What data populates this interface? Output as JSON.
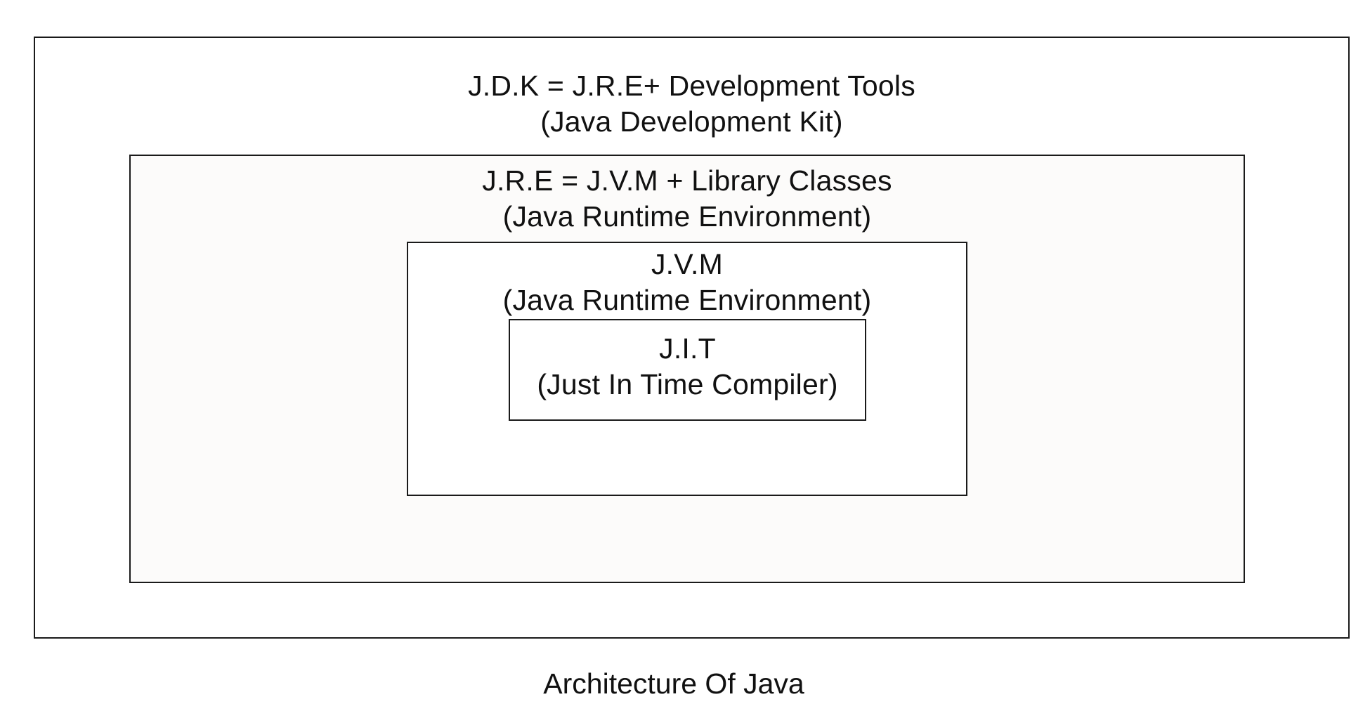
{
  "diagram": {
    "jdk": {
      "line1": "J.D.K = J.R.E+ Development Tools",
      "line2": "(Java Development Kit)"
    },
    "jre": {
      "line1": "J.R.E = J.V.M + Library Classes",
      "line2": "(Java Runtime Environment)"
    },
    "jvm": {
      "line1": "J.V.M",
      "line2": "(Java Runtime Environment)"
    },
    "jit": {
      "line1": "J.I.T",
      "line2": "(Just In Time Compiler)"
    },
    "caption": "Architecture Of Java"
  }
}
